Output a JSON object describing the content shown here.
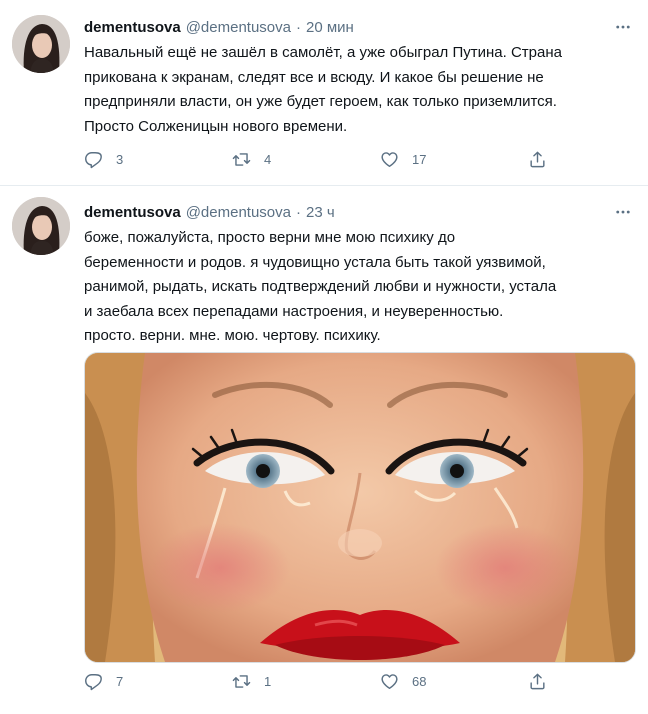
{
  "tweets": [
    {
      "name": "dementusova",
      "handle": "@dementusova",
      "dot": "·",
      "time": "20 мин",
      "text": "Навальный ещё не зашёл в самолёт, а уже обыграл Путина. Страна\nприкована к экранам, следят все и всюду. И какое бы решение не\nпредприняли власти, он уже будет героем, как только приземлится.\nПросто Солженицын нового времени.",
      "replies": "3",
      "retweets": "4",
      "likes": "17"
    },
    {
      "name": "dementusova",
      "handle": "@dementusova",
      "dot": "·",
      "time": "23 ч",
      "text": "боже, пожалуйста, просто верни мне мою психику до\nбеременности и родов. я чудовищно устала быть такой уязвимой,\nранимой, рыдать, искать подтверждений любви и нужности, устала\nи заебала всех перепадами настроения, и неуверенностью.\nпросто. верни. мне. мою. чертову. психику.",
      "replies": "7",
      "retweets": "1",
      "likes": "68"
    }
  ],
  "icons": {
    "more": "more-icon",
    "reply": "reply-icon",
    "retweet": "retweet-icon",
    "like": "heart-icon",
    "share": "share-icon"
  },
  "colors": {
    "muted": "#5b7083",
    "text": "#0f1419",
    "divider": "#e6ecf0",
    "lips": "#c8101a"
  }
}
